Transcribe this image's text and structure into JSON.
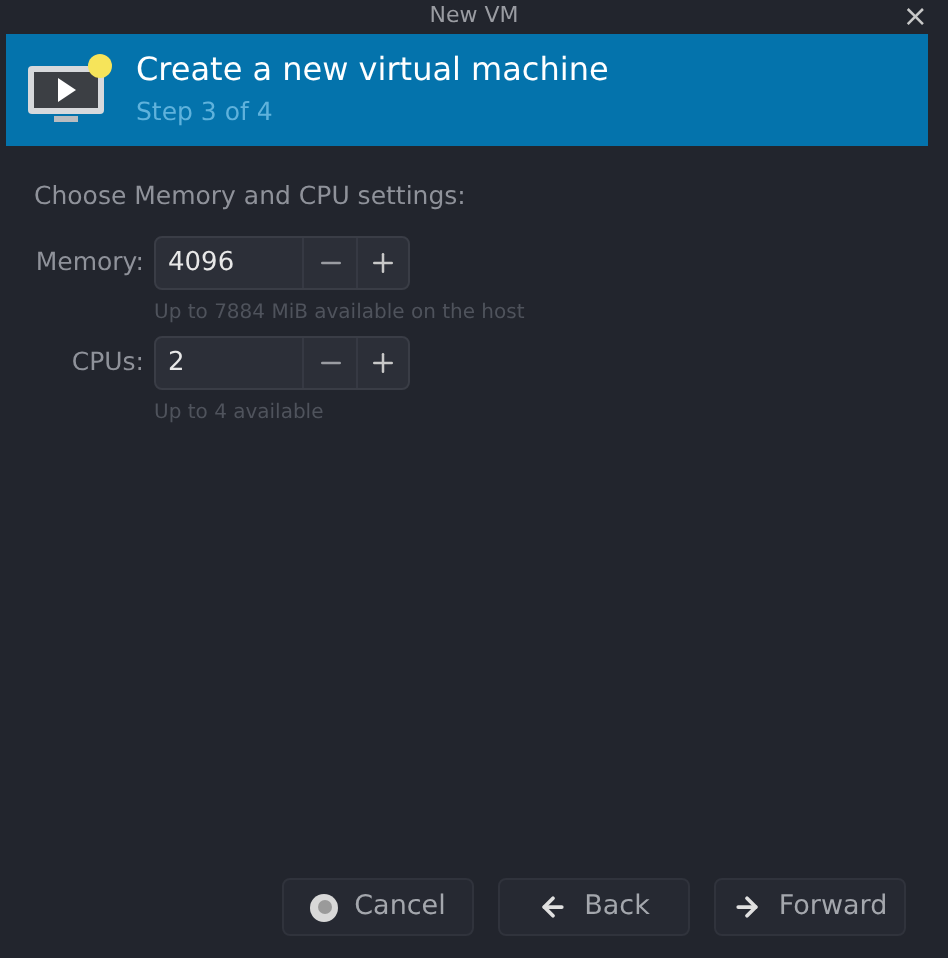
{
  "window": {
    "title": "New VM",
    "close": "×"
  },
  "header": {
    "title": "Create a new virtual machine",
    "subtitle": "Step 3 of 4"
  },
  "section_label": "Choose Memory and CPU settings:",
  "fields": [
    {
      "label": "Memory:",
      "value": "4096",
      "hint": "Up to 7884 MiB available on the host"
    },
    {
      "label": "CPUs:",
      "value": "2",
      "hint": "Up to 4 available"
    }
  ],
  "buttons": [
    {
      "kind": "cancel",
      "label": "Cancel"
    },
    {
      "kind": "back",
      "label": "Back"
    },
    {
      "kind": "forward",
      "label": "Forward"
    }
  ]
}
